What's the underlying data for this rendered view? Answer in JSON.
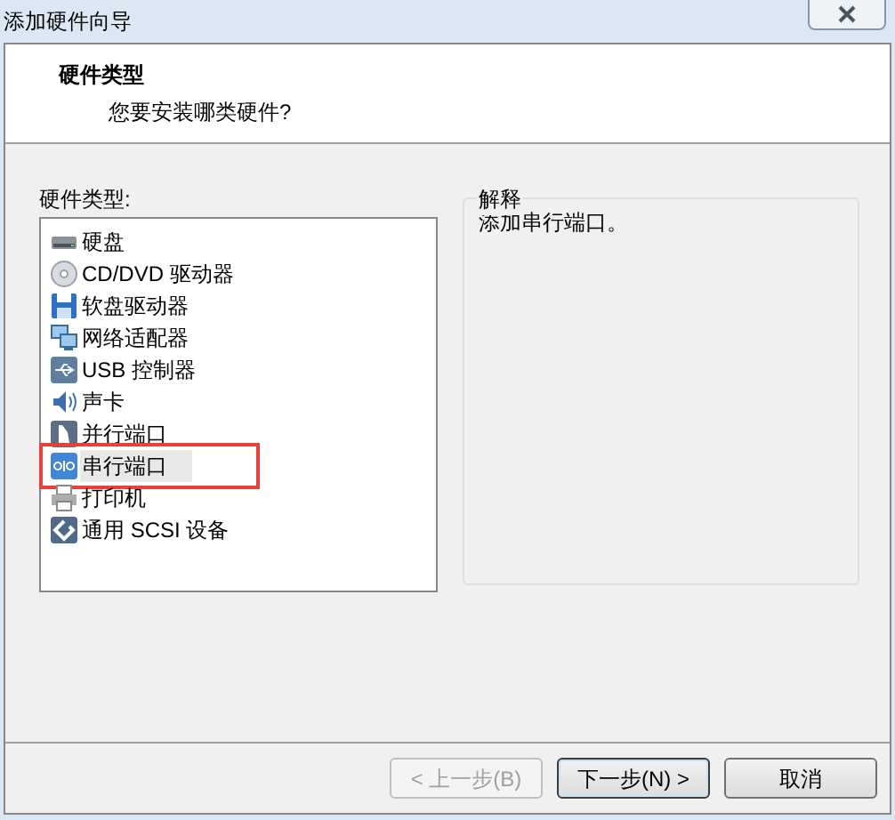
{
  "window": {
    "title": "添加硬件向导"
  },
  "header": {
    "title": "硬件类型",
    "subtitle": "您要安装哪类硬件?"
  },
  "hardware_list": {
    "label": "硬件类型:",
    "items": [
      {
        "kind": "disk",
        "label": "硬盘",
        "selected": false,
        "highlighted": false
      },
      {
        "kind": "cd",
        "label": "CD/DVD 驱动器",
        "selected": false,
        "highlighted": false
      },
      {
        "kind": "floppy",
        "label": "软盘驱动器",
        "selected": false,
        "highlighted": false
      },
      {
        "kind": "network",
        "label": "网络适配器",
        "selected": false,
        "highlighted": false
      },
      {
        "kind": "usb",
        "label": "USB 控制器",
        "selected": false,
        "highlighted": false
      },
      {
        "kind": "sound",
        "label": "声卡",
        "selected": false,
        "highlighted": false
      },
      {
        "kind": "parallel",
        "label": "并行端口",
        "selected": false,
        "highlighted": false
      },
      {
        "kind": "serial",
        "label": "串行端口",
        "selected": true,
        "highlighted": true
      },
      {
        "kind": "printer",
        "label": "打印机",
        "selected": false,
        "highlighted": false
      },
      {
        "kind": "scsi",
        "label": "通用 SCSI 设备",
        "selected": false,
        "highlighted": false
      }
    ]
  },
  "explanation": {
    "label": "解释",
    "text": "添加串行端口。"
  },
  "buttons": [
    {
      "label": "< 上一步(B)",
      "disabled": true,
      "default": false
    },
    {
      "label": "下一步(N) >",
      "disabled": false,
      "default": true
    },
    {
      "label": "取消",
      "disabled": false,
      "default": false
    }
  ]
}
